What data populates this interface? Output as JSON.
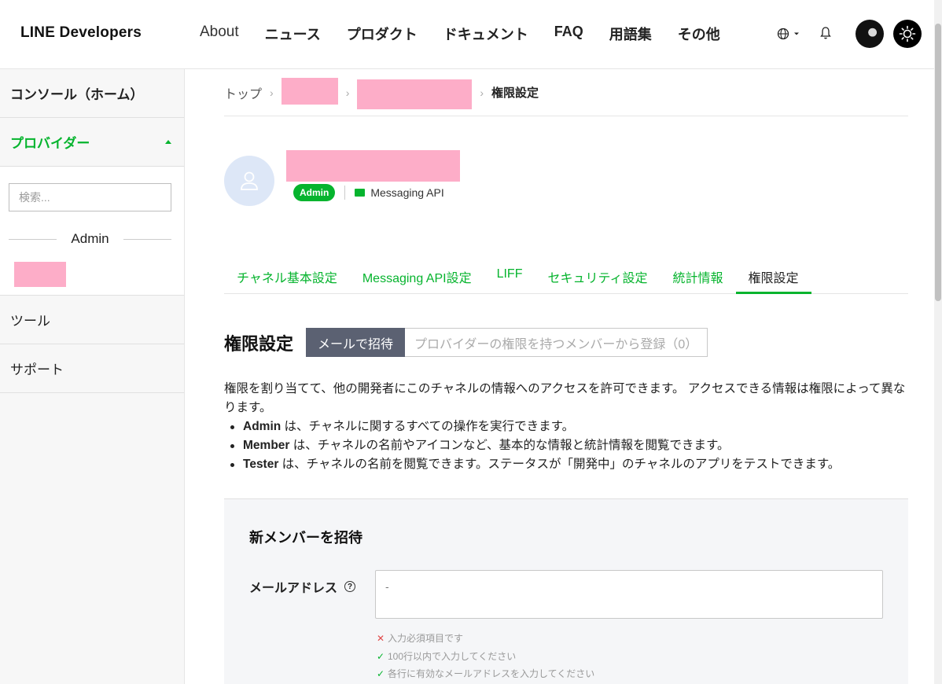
{
  "header": {
    "logo": "LINE Developers",
    "nav": [
      "About",
      "ニュース",
      "プロダクト",
      "ドキュメント",
      "FAQ",
      "用語集",
      "その他"
    ]
  },
  "sidebar": {
    "console_home": "コンソール（ホーム）",
    "providers": "プロバイダー",
    "search_placeholder": "検索...",
    "divider_label": "Admin",
    "tools": "ツール",
    "support": "サポート"
  },
  "breadcrumb": {
    "top": "トップ",
    "current": "権限設定"
  },
  "channel": {
    "role_badge": "Admin",
    "type": "Messaging API"
  },
  "tabs": [
    "チャネル基本設定",
    "Messaging API設定",
    "LIFF",
    "セキュリティ設定",
    "統計情報",
    "権限設定"
  ],
  "permissions": {
    "title": "権限設定",
    "segment_active": "メールで招待",
    "segment_inactive": "プロバイダーの権限を持つメンバーから登録（0）",
    "intro": "権限を割り当てて、他の開発者にこのチャネルの情報へのアクセスを許可できます。 アクセスできる情報は権限によって異なります。",
    "roles": [
      {
        "name": "Admin",
        "text": " は、チャネルに関するすべての操作を実行できます。"
      },
      {
        "name": "Member",
        "text": " は、チャネルの名前やアイコンなど、基本的な情報と統計情報を閲覧できます。"
      },
      {
        "name": "Tester",
        "text": " は、チャネルの名前を閲覧できます。ステータスが「開発中」のチャネルのアプリをテストできます。"
      }
    ]
  },
  "invite": {
    "title": "新メンバーを招待",
    "email_label": "メールアドレス",
    "email_placeholder": "-",
    "rules": [
      {
        "status": "error",
        "text": "入力必須項目です"
      },
      {
        "status": "ok",
        "text": "100行以内で入力してください"
      },
      {
        "status": "ok",
        "text": "各行に有効なメールアドレスを入力してください"
      }
    ]
  }
}
